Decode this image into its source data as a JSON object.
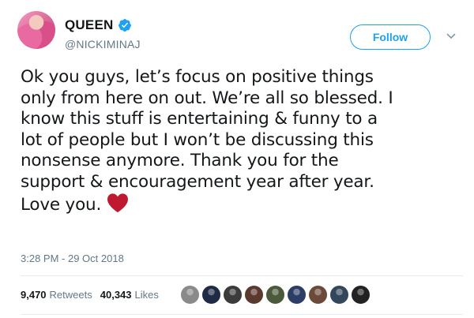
{
  "author": {
    "display_name": "QUEEN",
    "handle": "@NICKIMINAJ",
    "avatar_icon": "avatar-photo",
    "verified_icon": "verified-badge-icon"
  },
  "follow_button": {
    "label": "Follow"
  },
  "menu_icon": "chevron-down-icon",
  "tweet": {
    "lines": [
      "Ok you guys, let’s focus on positive things",
      "only from here on out. We’re all so blessed. I",
      "know this stuff is entertaining & funny to a",
      "lot of people but I won’t be discussing this",
      "nonsense anymore. Thank you for the",
      "support & encouragement year after year.",
      "Love you."
    ],
    "emoji_icon": "red-heart-icon"
  },
  "timestamp": "3:28 PM - 29 Oct 2018",
  "stats": {
    "retweets_count": "9,470",
    "retweets_label": "Retweets",
    "likes_count": "40,343",
    "likes_label": "Likes"
  },
  "likers": [
    {
      "icon": "liker-avatar-1",
      "color": "#8a8a8a"
    },
    {
      "icon": "liker-avatar-2",
      "color": "#1f2a44"
    },
    {
      "icon": "liker-avatar-3",
      "color": "#3b3b3b"
    },
    {
      "icon": "liker-avatar-4",
      "color": "#5a3a2e"
    },
    {
      "icon": "liker-avatar-5",
      "color": "#4a5a3a"
    },
    {
      "icon": "liker-avatar-6",
      "color": "#2c3e66"
    },
    {
      "icon": "liker-avatar-7",
      "color": "#6b4a3a"
    },
    {
      "icon": "liker-avatar-8",
      "color": "#33475b"
    },
    {
      "icon": "liker-avatar-9",
      "color": "#222222"
    }
  ],
  "colors": {
    "accent": "#1da1f2",
    "secondary_text": "#657786",
    "heart": "#be1931"
  }
}
